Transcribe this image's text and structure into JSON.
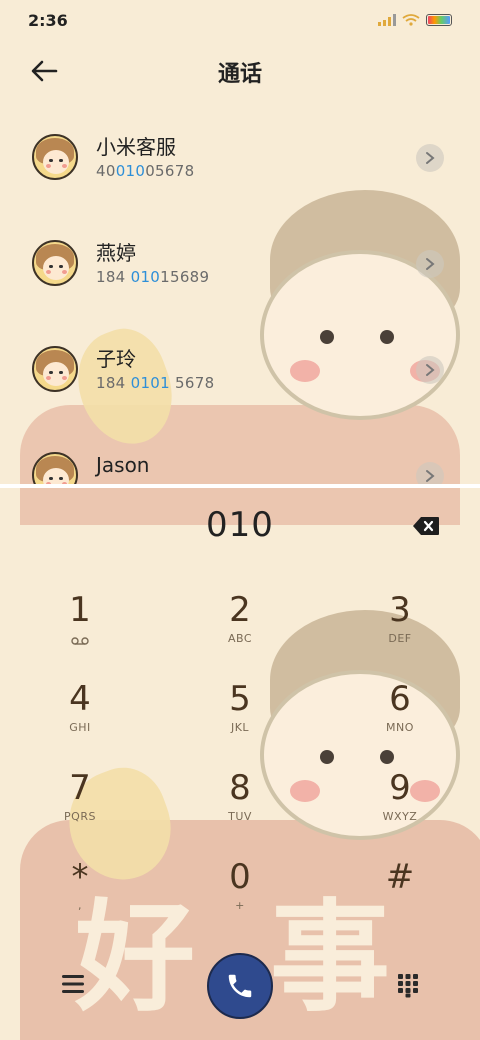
{
  "status_bar": {
    "time": "2:36",
    "icons": [
      "signal-icon",
      "wifi-icon",
      "battery-icon"
    ]
  },
  "header": {
    "title": "通话",
    "back_icon": "back-arrow-icon"
  },
  "contacts": [
    {
      "name": "小米客服",
      "number_pre": "40",
      "number_hl": "010",
      "number_post": "05678",
      "chevron_icon": "chevron-right-icon"
    },
    {
      "name": "燕婷",
      "number_pre": "184 ",
      "number_hl": "010",
      "number_post": "15689",
      "chevron_icon": "chevron-right-icon"
    },
    {
      "name": "子玲",
      "number_pre": "184 ",
      "number_hl": "0101",
      "number_post": " 5678",
      "chevron_icon": "chevron-right-icon"
    },
    {
      "name": "Jason",
      "number_pre": "",
      "number_hl": "",
      "number_post": "",
      "chevron_icon": "chevron-right-icon"
    }
  ],
  "dial": {
    "input_value": "010",
    "backspace_icon": "backspace-icon"
  },
  "keypad": [
    {
      "digit": "1",
      "letters": "",
      "sub_icon": "voicemail-icon"
    },
    {
      "digit": "2",
      "letters": "ABC"
    },
    {
      "digit": "3",
      "letters": "DEF"
    },
    {
      "digit": "4",
      "letters": "GHI"
    },
    {
      "digit": "5",
      "letters": "JKL"
    },
    {
      "digit": "6",
      "letters": "MNO"
    },
    {
      "digit": "7",
      "letters": "PQRS"
    },
    {
      "digit": "8",
      "letters": "TUV"
    },
    {
      "digit": "9",
      "letters": "WXYZ"
    },
    {
      "digit": "*",
      "letters": ","
    },
    {
      "digit": "0",
      "letters": "+"
    },
    {
      "digit": "#",
      "letters": ""
    }
  ],
  "bottom_bar": {
    "menu_icon": "menu-icon",
    "call_icon": "phone-icon",
    "dialpad_icon": "dialpad-icon"
  },
  "wallpaper": {
    "chars": [
      "好",
      "事"
    ]
  },
  "colors": {
    "background": "#f8ecd6",
    "highlight": "#2e8fd8",
    "call_button": "#2f4a8e",
    "key_text": "#4a3520"
  }
}
